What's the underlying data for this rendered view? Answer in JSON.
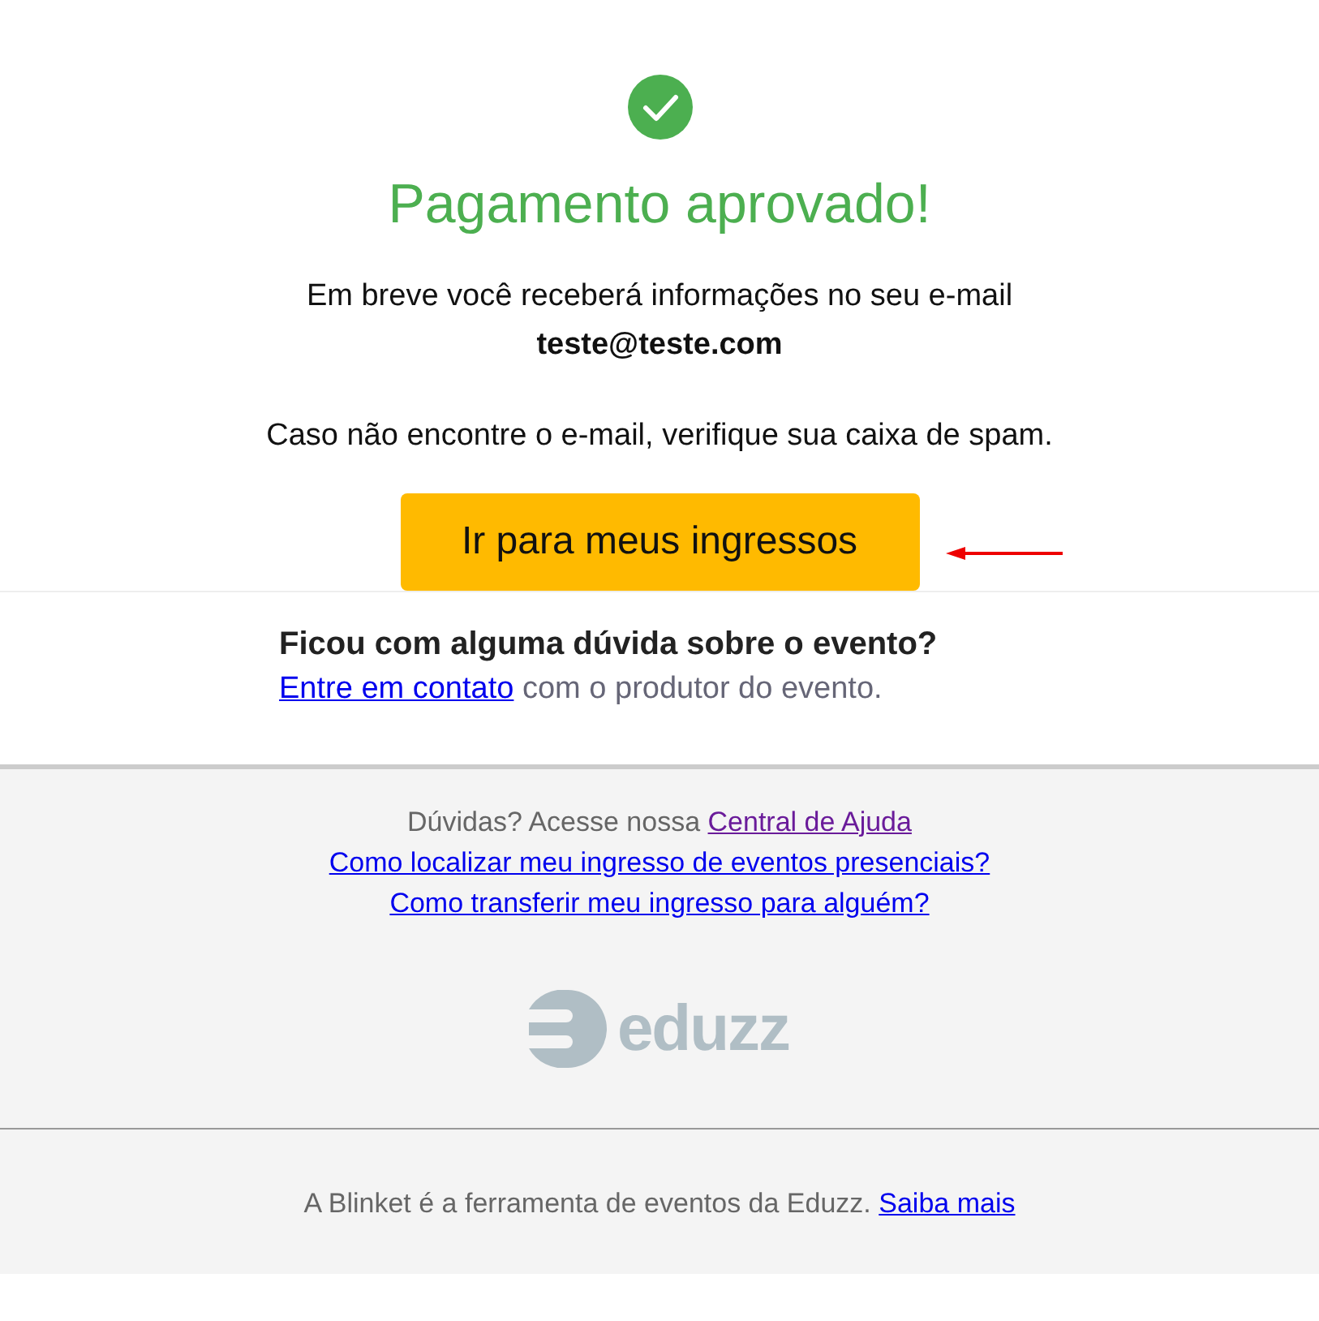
{
  "status_icon": {
    "kind": "success"
  },
  "title": "Pagamento aprovado!",
  "message": "Em breve você receberá informações no seu e-mail",
  "email": "teste@teste.com",
  "spam_note": "Caso não encontre o e-mail, verifique sua caixa de spam.",
  "primary_button": {
    "label": "Ir para meus ingressos",
    "annotation_arrow": true
  },
  "question": {
    "heading": "Ficou com alguma dúvida sobre o evento?",
    "link": "Entre em contato",
    "text": "com o produtor do evento."
  },
  "help": {
    "text": "Dúvidas? Acesse nossa",
    "link": {
      "label": "Central de Ajuda",
      "visited": true
    },
    "links": [
      {
        "label": "Como localizar meu ingresso de eventos presenciais?",
        "visited": false
      },
      {
        "label": "Como transferir meu ingresso para alguém?",
        "visited": false
      }
    ]
  },
  "logo": {
    "text": "eduzz"
  },
  "footer": {
    "text": "A Blinket é a ferramenta de eventos da Eduzz.",
    "link": "Saiba mais"
  }
}
